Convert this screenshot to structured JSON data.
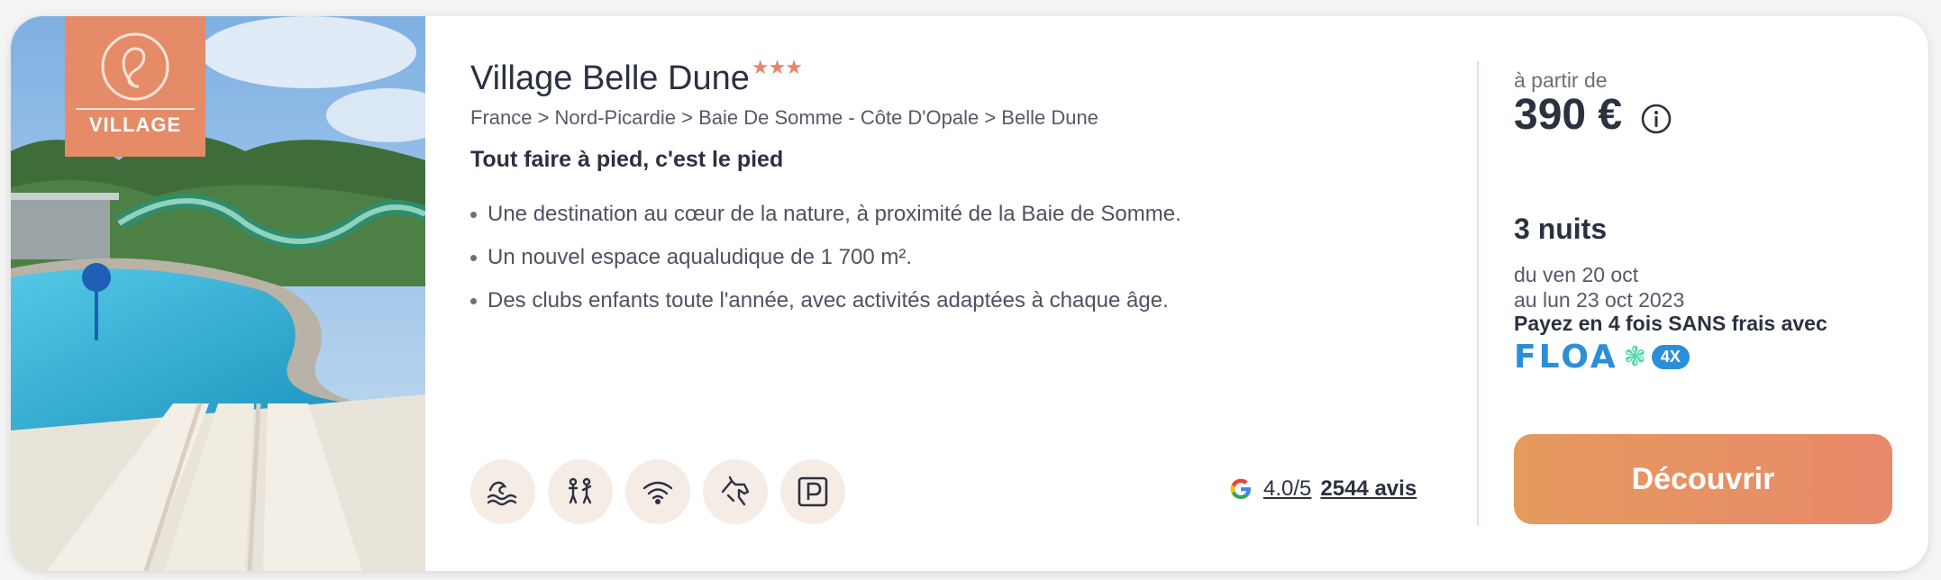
{
  "brand": {
    "badge_text": "VILLAGE"
  },
  "listing": {
    "title": "Village Belle Dune",
    "stars": "★★★",
    "breadcrumb": "France > Nord-Picardie > Baie De Somme - Côte D'Opale > Belle Dune",
    "tagline": "Tout faire à pied, c'est le pied",
    "features": [
      "Une destination au cœur de la nature, à proximité de la Baie de Somme.",
      "Un nouvel espace aqualudique de 1 700 m².",
      "Des clubs enfants toute l'année, avec activités adaptées à chaque âge."
    ],
    "amenities": [
      "waves-icon",
      "kids-club-icon",
      "wifi-icon",
      "horse-icon",
      "parking-icon"
    ]
  },
  "rating": {
    "score": "4.0/5",
    "count": "2544 avis"
  },
  "pricing": {
    "from_label": "à partir de",
    "price": "390 €",
    "nights": "3 nuits",
    "date_from": "du ven 20 oct",
    "date_to": "au lun 23 oct 2023",
    "payment": "Payez en 4 fois SANS frais avec",
    "floa_word": "FLOA",
    "floa_badge": "4X"
  },
  "cta": {
    "label": "Découvrir"
  },
  "colors": {
    "accent": "#e58b68",
    "text": "#2b3140",
    "floa_blue": "#2b8ed9"
  }
}
